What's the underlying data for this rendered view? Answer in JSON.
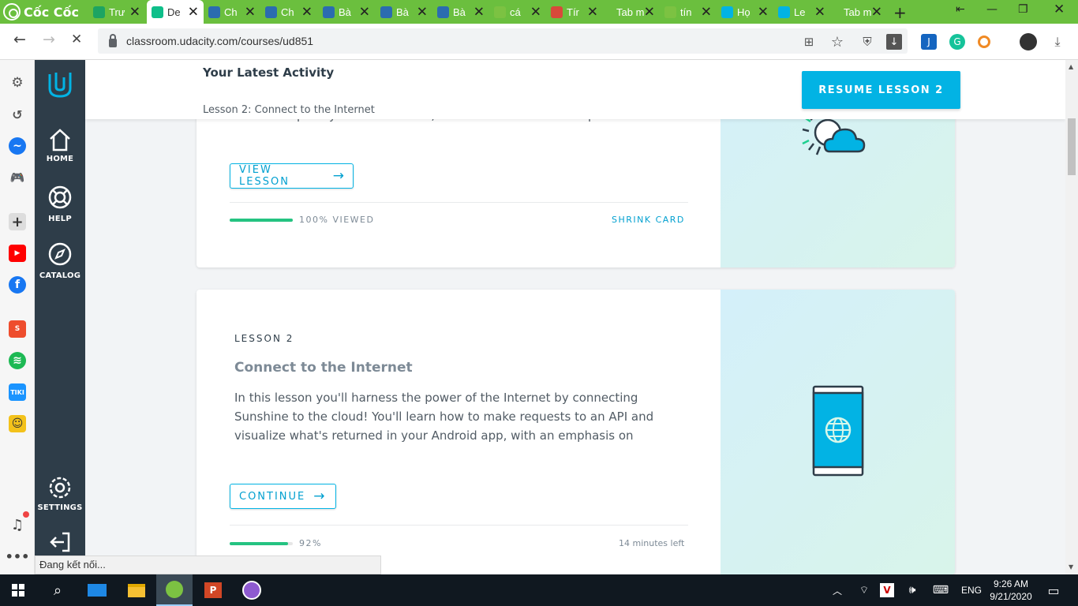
{
  "browser": {
    "brand": "Cốc Cốc",
    "tabs": [
      {
        "title": "Trư",
        "color": "#1da462",
        "active": false
      },
      {
        "title": "De",
        "color": "#0fbf8a",
        "active": true
      },
      {
        "title": "Ch",
        "color": "#2b6cb0",
        "active": false
      },
      {
        "title": "Ch",
        "color": "#2b6cb0",
        "active": false
      },
      {
        "title": "Bà",
        "color": "#2b6cb0",
        "active": false
      },
      {
        "title": "Bà",
        "color": "#2b6cb0",
        "active": false
      },
      {
        "title": "Bà",
        "color": "#2b6cb0",
        "active": false
      },
      {
        "title": "cá",
        "color": "#7cc242",
        "active": false
      },
      {
        "title": "Tír",
        "color": "#d84a3a",
        "active": false
      },
      {
        "title": "Tab m",
        "color": "",
        "active": false
      },
      {
        "title": "tín",
        "color": "#7cc242",
        "active": false
      },
      {
        "title": "Họ",
        "color": "#02b3e4",
        "active": false
      },
      {
        "title": "Le",
        "color": "#02b3e4",
        "active": false
      },
      {
        "title": "Tab m",
        "color": "",
        "active": false
      }
    ],
    "url": "classroom.udacity.com/courses/ud851",
    "status_text": "Đang kết nối..."
  },
  "udacity_nav": {
    "home": "HOME",
    "help": "HELP",
    "catalog": "CATALOG",
    "settings": "SETTINGS"
  },
  "activity": {
    "heading": "Your Latest Activity",
    "lesson": "Lesson 2: Connect to the Internet",
    "resume_button": "RESUME LESSON 2"
  },
  "card1": {
    "desc_line": "create simple layouts for Android, how Android runs on the phone and the",
    "view_button": "VIEW LESSON",
    "progress_label": "100% VIEWED",
    "progress": 1.0,
    "shrink": "SHRINK CARD"
  },
  "card2": {
    "eyebrow": "LESSON 2",
    "title": "Connect to the Internet",
    "desc": [
      "In this lesson you'll harness the power of the Internet by connecting",
      "Sunshine to the cloud! You'll learn how to make requests to an API and",
      "visualize what's returned in your Android app, with an emphasis on"
    ],
    "continue_button": "CONTINUE",
    "progress_label": "92%",
    "progress": 0.92,
    "time_left": "14 minutes left"
  },
  "taskbar": {
    "lang": "ENG",
    "time": "9:26 AM",
    "date": "9/21/2020"
  }
}
